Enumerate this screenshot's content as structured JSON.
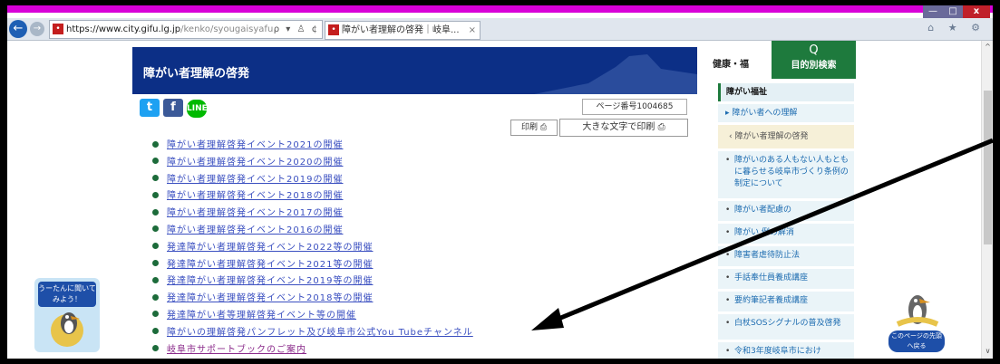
{
  "browser": {
    "url_host": "https://www.city.gifu.lg.jp",
    "url_path": "/kenko/syougaisyafu",
    "url_tools": "ρ ▾ ♙ ¢",
    "tab_title": "障がい者理解の啓発｜岐阜...",
    "tab_close": "×",
    "window": {
      "minimize": "—",
      "maximize": "□",
      "close": "x"
    },
    "toolbar_icons": "⌂ ★ ⚙"
  },
  "page": {
    "title": "障がい者理解の啓発",
    "page_number": "ページ番号1004685",
    "print_label": "印刷",
    "big_print_label": "大きな文字で印刷",
    "share": {
      "twitter": "t",
      "facebook": "f",
      "line": "LINE"
    },
    "links": [
      {
        "text": "障がい者理解啓発イベント2021の開催"
      },
      {
        "text": "障がい者理解啓発イベント2020の開催"
      },
      {
        "text": "障がい者理解啓発イベント2019の開催"
      },
      {
        "text": "障がい者理解啓発イベント2018の開催"
      },
      {
        "text": "障がい者理解啓発イベント2017の開催"
      },
      {
        "text": "障がい者理解啓発イベント2016の開催"
      },
      {
        "text": "発達障がい者理解啓発イベント2022等の開催"
      },
      {
        "text": "発達障がい者理解啓発イベント2021等の開催"
      },
      {
        "text": "発達障がい者理解啓発イベント2019等の開催"
      },
      {
        "text": "発達障がい者理解啓発イベント2018等の開催"
      },
      {
        "text": "発達障がい者等理解啓発イベント等の開催"
      },
      {
        "text": "障がいの理解啓発パンフレット及び岐阜市公式You Tubeチャンネル"
      },
      {
        "text": "岐阜市サポートブックのご案内"
      }
    ]
  },
  "sidebar": {
    "search_icon": "Q",
    "search_label": "目的別検索",
    "heading": "健康・福",
    "category": "障がい福祉",
    "sub": "障がい者への理解",
    "active": "障がい者理解の啓発",
    "items": [
      "障がいのある人もない人もともに暮らせる岐阜市づくり条例の制定について",
      "障がい者配慮の",
      "障がい 例の解消",
      "障害者虐待防止法",
      "手話奉仕員養成講座",
      "要約筆記者養成講座",
      "白杖SOSシグナルの普及啓発",
      "令和3年度岐阜市におけ"
    ]
  },
  "mascot": {
    "bubble": "うーたんに聞いてみよう！",
    "totop": "このページの先頭へ戻る"
  },
  "colors": {
    "banner": "#0c2f86",
    "accent_green": "#1e7a3d",
    "link": "#3a4fc0",
    "title_bar": "#d800d8"
  }
}
